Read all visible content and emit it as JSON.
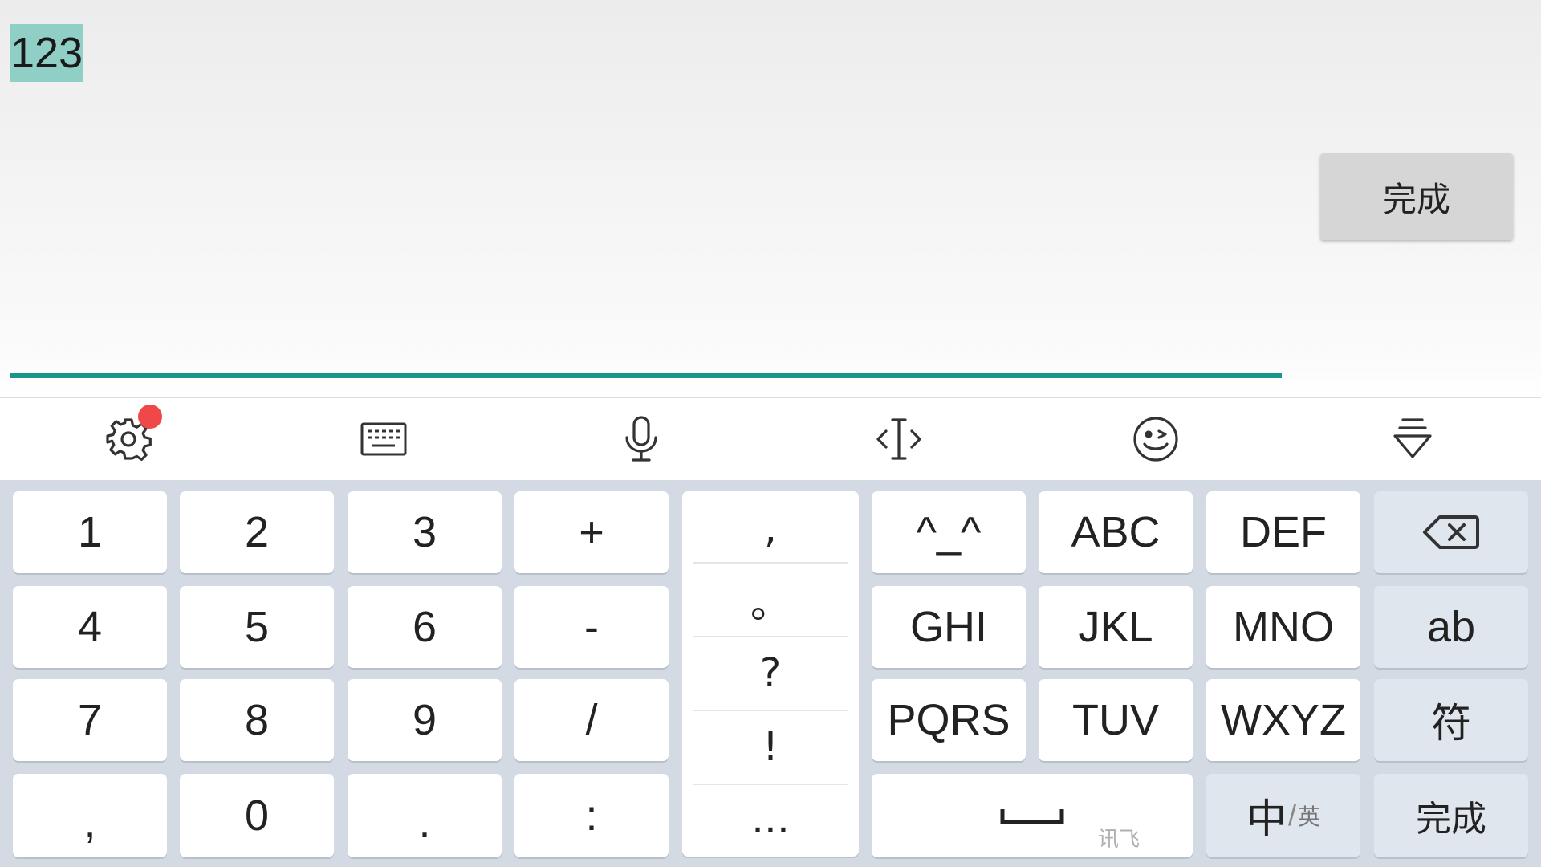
{
  "input": {
    "value": "123",
    "done_label": "完成"
  },
  "toolbar": {
    "icons": [
      "settings-icon",
      "keyboard-icon",
      "microphone-icon",
      "cursor-move-icon",
      "emoji-icon",
      "hide-keyboard-icon"
    ],
    "settings_has_notification": true
  },
  "keyboard": {
    "digits": [
      "1",
      "2",
      "3",
      "4",
      "5",
      "6",
      "7",
      "8",
      "9"
    ],
    "operators": [
      "+",
      "-",
      "/"
    ],
    "bottom_row": [
      ",",
      "0",
      ".",
      ":"
    ],
    "punctuation": [
      ",",
      "。",
      "?",
      "!",
      "..."
    ],
    "t9": [
      "^_^",
      "ABC",
      "DEF",
      "GHI",
      "JKL",
      "MNO",
      "PQRS",
      "TUV",
      "WXYZ"
    ],
    "func_ab": "ab",
    "func_symbols": "符",
    "space_brand": "讯飞",
    "lang_main": "中",
    "lang_alt": "英",
    "done_label": "完成"
  },
  "colors": {
    "accent": "#1a9589",
    "selection": "#8fcfc6",
    "keyboard_bg": "#d3dae3",
    "notification": "#f04848"
  }
}
